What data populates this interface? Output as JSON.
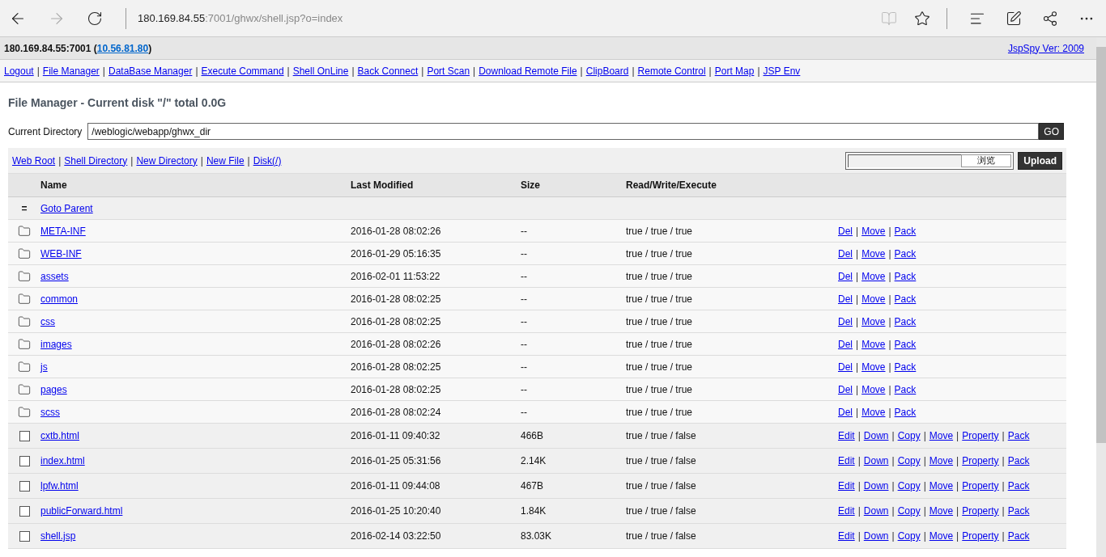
{
  "browser": {
    "address_host": "180.169.84.55",
    "address_path": ":7001/ghwx/shell.jsp?o=index",
    "forward_disabled": true,
    "reading_view_disabled": true
  },
  "header": {
    "host": "180.169.84.55:7001 (",
    "ip": "10.56.81.80",
    "close": ")",
    "version": "JspSpy Ver: 2009"
  },
  "nav": [
    "Logout",
    "|",
    "File Manager",
    "|",
    "DataBase Manager",
    "|",
    "Execute Command",
    "|",
    "Shell OnLine",
    "|",
    "Back Connect",
    "|",
    "Port Scan",
    "|",
    "Download Remote File",
    "|",
    "ClipBoard",
    "|",
    "Remote Control",
    "|",
    "Port Map",
    "|",
    "JSP Env"
  ],
  "title": "File Manager - Current disk \"/\" total 0.0G",
  "directory": {
    "label": "Current Directory",
    "value": "/weblogic/webapp/ghwx_dir",
    "button": "GO"
  },
  "toolbar": {
    "links": [
      "Web Root",
      "|",
      "Shell Directory",
      "|",
      "New Directory",
      "|",
      "New File",
      "|",
      "Disk(/)"
    ],
    "browse": "浏览",
    "upload": "Upload"
  },
  "table": {
    "columns": [
      "Name",
      "Last Modified",
      "Size",
      "Read/Write/Execute"
    ],
    "parent": {
      "icon": "=",
      "label": "Goto Parent"
    },
    "rows": [
      {
        "kind": "folder",
        "name": "META-INF",
        "modified": "2016-01-28 08:02:26",
        "size": "--",
        "rwx": "true / true / true",
        "actions": [
          "Del",
          "|",
          "Move",
          "|",
          "Pack"
        ]
      },
      {
        "kind": "folder",
        "name": "WEB-INF",
        "modified": "2016-01-29 05:16:35",
        "size": "--",
        "rwx": "true / true / true",
        "actions": [
          "Del",
          "|",
          "Move",
          "|",
          "Pack"
        ]
      },
      {
        "kind": "folder",
        "name": "assets",
        "modified": "2016-02-01 11:53:22",
        "size": "--",
        "rwx": "true / true / true",
        "actions": [
          "Del",
          "|",
          "Move",
          "|",
          "Pack"
        ]
      },
      {
        "kind": "folder",
        "name": "common",
        "modified": "2016-01-28 08:02:25",
        "size": "--",
        "rwx": "true / true / true",
        "actions": [
          "Del",
          "|",
          "Move",
          "|",
          "Pack"
        ]
      },
      {
        "kind": "folder",
        "name": "css",
        "modified": "2016-01-28 08:02:25",
        "size": "--",
        "rwx": "true / true / true",
        "actions": [
          "Del",
          "|",
          "Move",
          "|",
          "Pack"
        ]
      },
      {
        "kind": "folder",
        "name": "images",
        "modified": "2016-01-28 08:02:26",
        "size": "--",
        "rwx": "true / true / true",
        "actions": [
          "Del",
          "|",
          "Move",
          "|",
          "Pack"
        ]
      },
      {
        "kind": "folder",
        "name": "js",
        "modified": "2016-01-28 08:02:25",
        "size": "--",
        "rwx": "true / true / true",
        "actions": [
          "Del",
          "|",
          "Move",
          "|",
          "Pack"
        ]
      },
      {
        "kind": "folder",
        "name": "pages",
        "modified": "2016-01-28 08:02:25",
        "size": "--",
        "rwx": "true / true / true",
        "actions": [
          "Del",
          "|",
          "Move",
          "|",
          "Pack"
        ]
      },
      {
        "kind": "folder",
        "name": "scss",
        "modified": "2016-01-28 08:02:24",
        "size": "--",
        "rwx": "true / true / true",
        "actions": [
          "Del",
          "|",
          "Move",
          "|",
          "Pack"
        ]
      },
      {
        "kind": "file",
        "checked": false,
        "name": "cxtb.html",
        "modified": "2016-01-11 09:40:32",
        "size": "466B",
        "rwx": "true / true / false",
        "actions": [
          "Edit",
          "|",
          "Down",
          "|",
          "Copy",
          "|",
          "Move",
          "|",
          "Property",
          "|",
          "Pack"
        ]
      },
      {
        "kind": "file",
        "checked": false,
        "name": "index.html",
        "modified": "2016-01-25 05:31:56",
        "size": "2.14K",
        "rwx": "true / true / false",
        "actions": [
          "Edit",
          "|",
          "Down",
          "|",
          "Copy",
          "|",
          "Move",
          "|",
          "Property",
          "|",
          "Pack"
        ]
      },
      {
        "kind": "file",
        "checked": false,
        "name": "lpfw.html",
        "modified": "2016-01-11 09:44:08",
        "size": "467B",
        "rwx": "true / true / false",
        "actions": [
          "Edit",
          "|",
          "Down",
          "|",
          "Copy",
          "|",
          "Move",
          "|",
          "Property",
          "|",
          "Pack"
        ]
      },
      {
        "kind": "file",
        "checked": false,
        "name": "publicForward.html",
        "modified": "2016-01-25 10:20:40",
        "size": "1.84K",
        "rwx": "true / true / false",
        "actions": [
          "Edit",
          "|",
          "Down",
          "|",
          "Copy",
          "|",
          "Move",
          "|",
          "Property",
          "|",
          "Pack"
        ]
      },
      {
        "kind": "file",
        "checked": false,
        "name": "shell.jsp",
        "modified": "2016-02-14 03:22:50",
        "size": "83.03K",
        "rwx": "true / true / false",
        "actions": [
          "Edit",
          "|",
          "Down",
          "|",
          "Copy",
          "|",
          "Move",
          "|",
          "Property",
          "|",
          "Pack"
        ]
      }
    ]
  }
}
